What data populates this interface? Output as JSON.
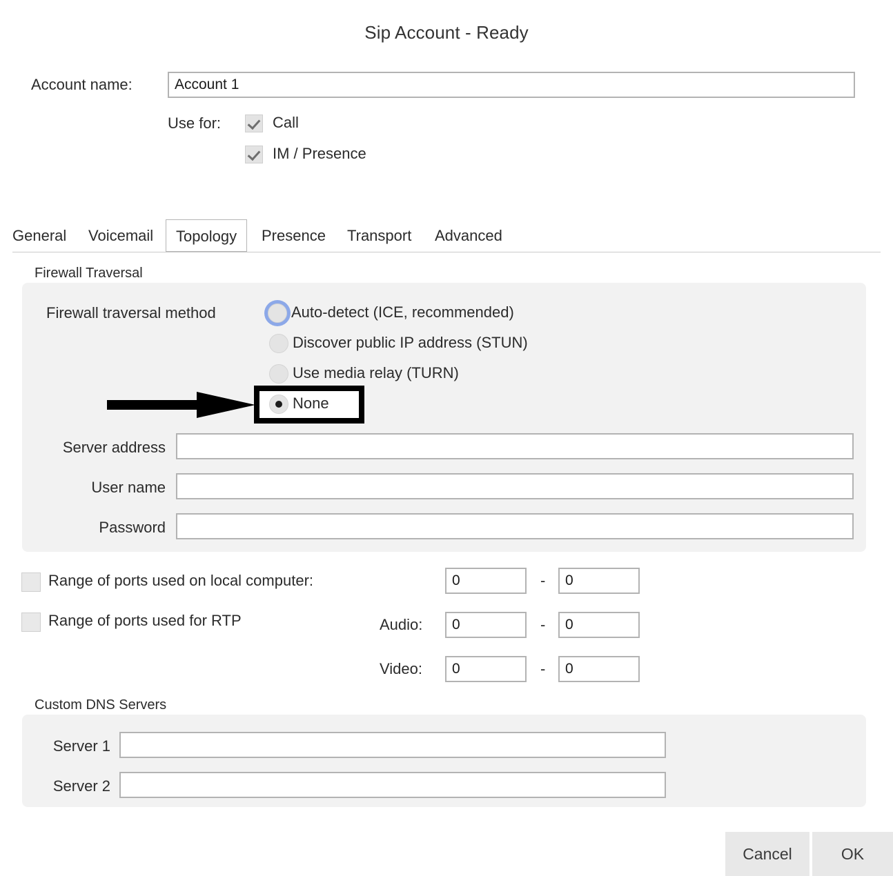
{
  "dialog": {
    "title": "Sip Account - Ready"
  },
  "account": {
    "name_label": "Account name:",
    "name_value": "Account 1",
    "use_for_label": "Use for:",
    "use_for": [
      {
        "label": "Call",
        "checked": true
      },
      {
        "label": "IM / Presence",
        "checked": true
      }
    ]
  },
  "tabs": [
    {
      "label": "General",
      "selected": false
    },
    {
      "label": "Voicemail",
      "selected": false
    },
    {
      "label": "Topology",
      "selected": true
    },
    {
      "label": "Presence",
      "selected": false
    },
    {
      "label": "Transport",
      "selected": false
    },
    {
      "label": "Advanced",
      "selected": false
    }
  ],
  "firewall": {
    "group_caption": "Firewall Traversal",
    "method_label": "Firewall traversal method",
    "options": [
      {
        "label": "Auto-detect (ICE, recommended)",
        "selected": false,
        "focused": true
      },
      {
        "label": "Discover public IP address (STUN)",
        "selected": false,
        "focused": false
      },
      {
        "label": "Use media relay (TURN)",
        "selected": false,
        "focused": false
      },
      {
        "label": "None",
        "selected": true,
        "focused": false
      }
    ],
    "fields": [
      {
        "label": "Server address",
        "value": ""
      },
      {
        "label": "User name",
        "value": ""
      },
      {
        "label": "Password",
        "value": ""
      }
    ]
  },
  "ports": {
    "local_label": "Range of ports used on local computer:",
    "local_checked": false,
    "local_from": "0",
    "local_to": "0",
    "rtp_label": "Range of ports used for RTP",
    "rtp_checked": false,
    "audio_label": "Audio:",
    "audio_from": "0",
    "audio_to": "0",
    "video_label": "Video:",
    "video_from": "0",
    "video_to": "0",
    "separator": "-"
  },
  "dns": {
    "group_caption": "Custom DNS Servers",
    "servers": [
      {
        "label": "Server 1",
        "value": ""
      },
      {
        "label": "Server 2",
        "value": ""
      }
    ]
  },
  "footer": {
    "cancel_label": "Cancel",
    "ok_label": "OK"
  },
  "annotation": {
    "arrow_color": "#000000",
    "highlight_color": "#000000",
    "target": "None"
  }
}
